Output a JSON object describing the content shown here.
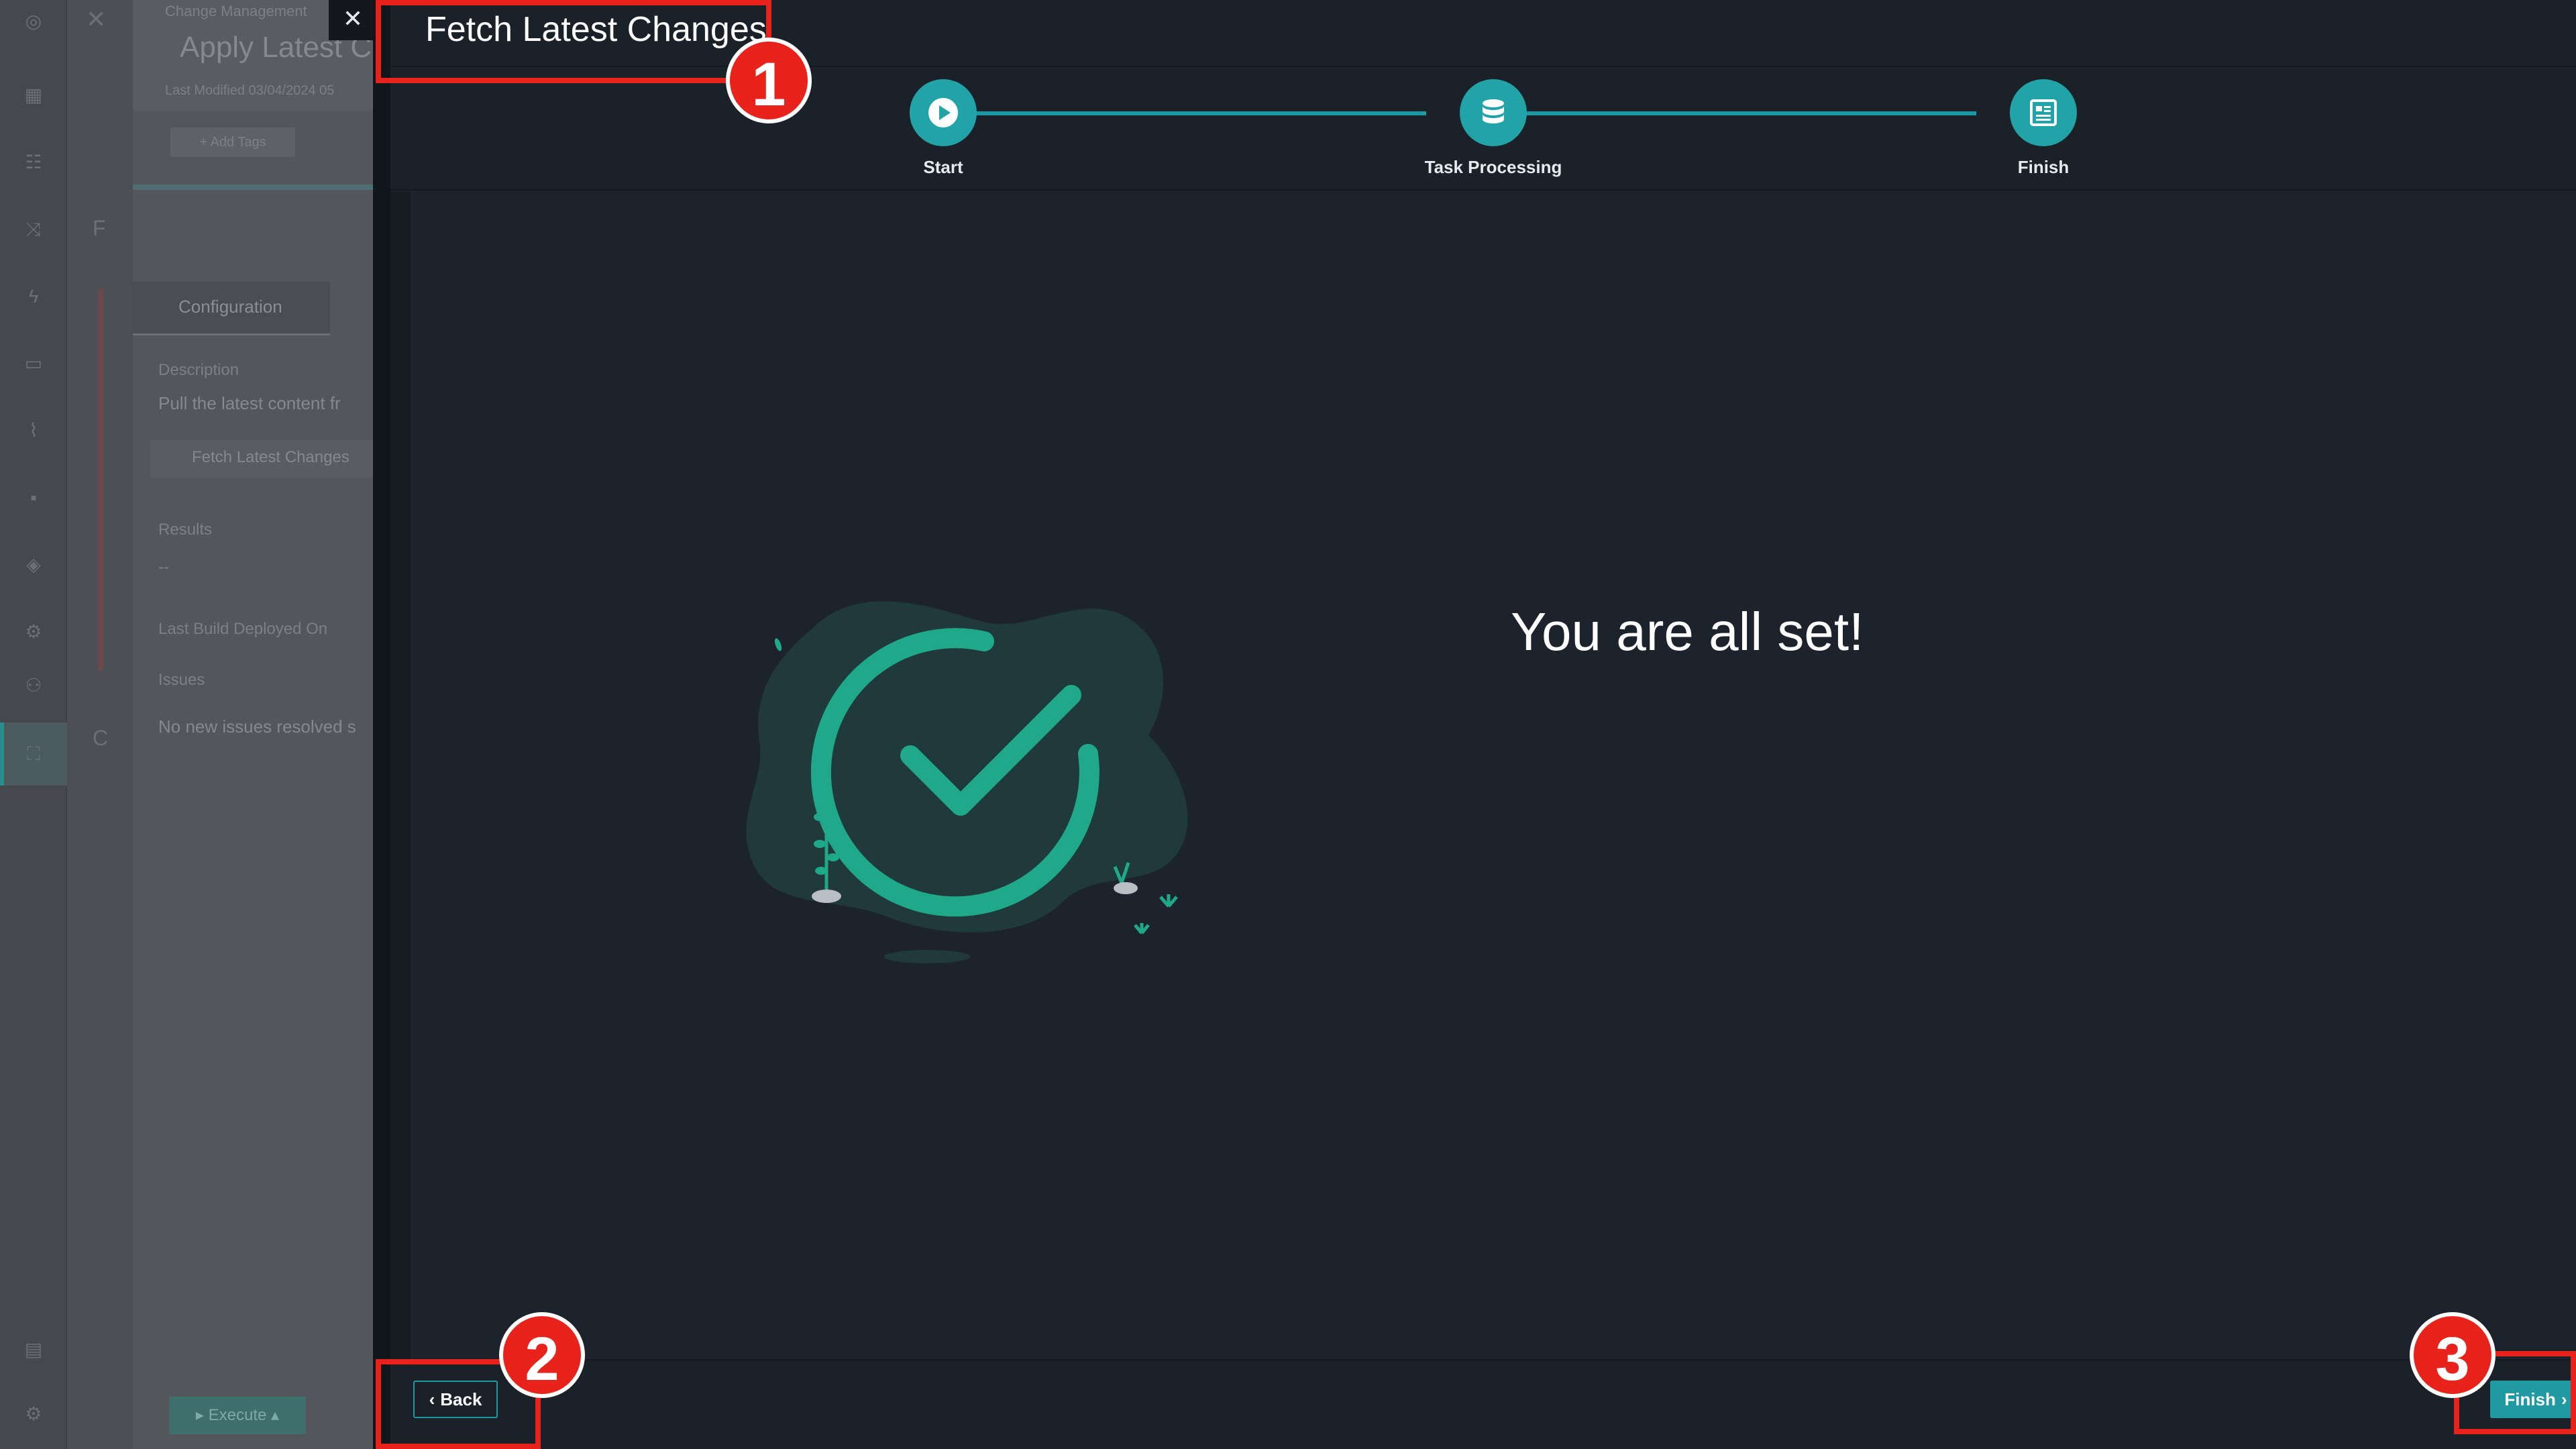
{
  "background_app": {
    "breadcrumb": "Change Management",
    "record_title": "Apply Latest C",
    "last_modified": "Last Modified 03/04/2024 05",
    "add_tags": "+ Add Tags",
    "tab_configuration": "Configuration",
    "description_label": "Description",
    "description_value": "Pull the latest content fr",
    "fetch_chip": "Fetch Latest Changes",
    "results_label": "Results",
    "results_value": "--",
    "last_build_label": "Last Build Deployed On",
    "issues_label": "Issues",
    "issues_value": "No new issues resolved s",
    "execute_button": "Execute",
    "strip_letter_f": "F",
    "strip_letter_c": "C"
  },
  "modal": {
    "title": "Fetch Latest Changes",
    "steps": [
      {
        "label": "Start",
        "icon": "play-icon"
      },
      {
        "label": "Task Processing",
        "icon": "database-icon"
      },
      {
        "label": "Finish",
        "icon": "report-icon"
      }
    ],
    "message": "You are all set!",
    "back_label": "Back",
    "finish_label": "Finish"
  },
  "annotations": [
    "1",
    "2",
    "3"
  ],
  "colors": {
    "accent": "#1f9aa2",
    "background": "#1d232c",
    "callout": "#e8231b",
    "success_green": "#1fa98a"
  }
}
